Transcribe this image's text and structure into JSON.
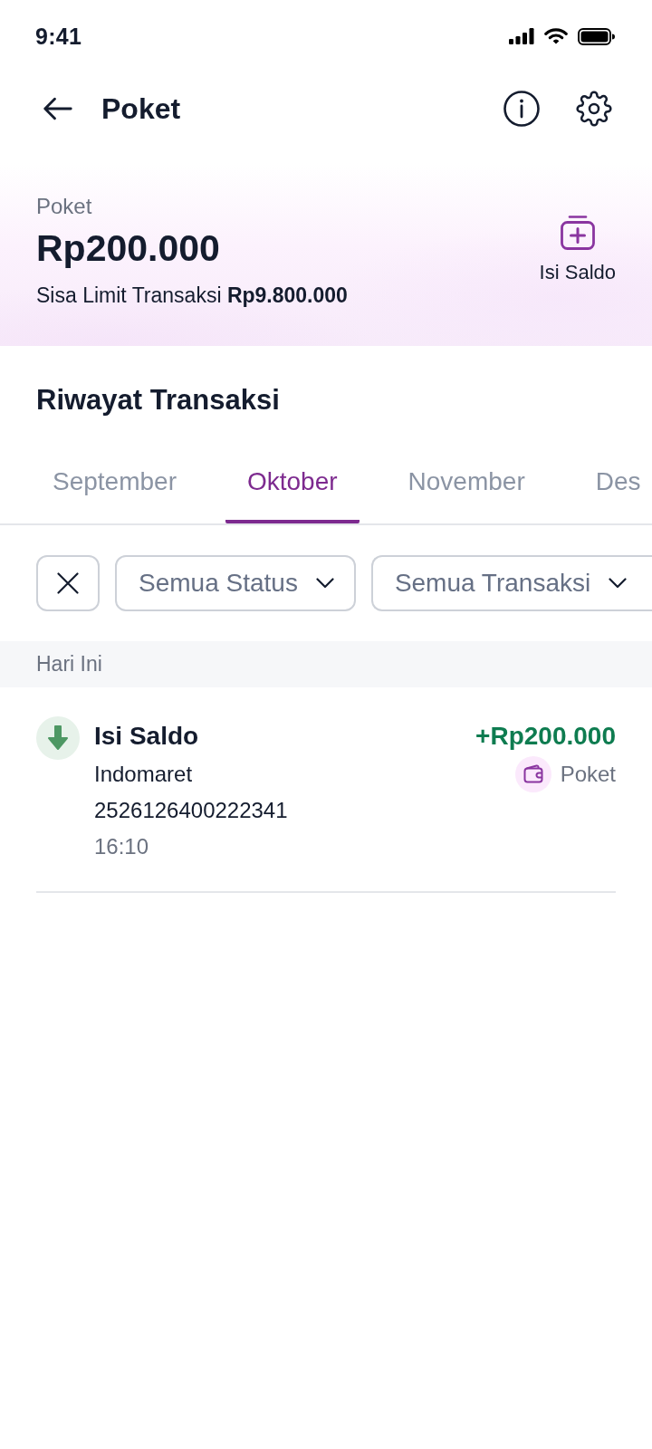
{
  "status_bar": {
    "time": "9:41"
  },
  "header": {
    "title": "Poket"
  },
  "balance_card": {
    "label": "Poket",
    "amount": "Rp200.000",
    "limit_text": "Sisa Limit Transaksi **Rp9.800.000**",
    "action": "Isi Saldo"
  },
  "history": {
    "title": "Riwayat Transaksi"
  },
  "tabs": [
    {
      "label": "September",
      "selected": false
    },
    {
      "label": "Oktober",
      "selected": true
    },
    {
      "label": "November",
      "selected": false
    },
    {
      "label": "Des",
      "selected": false
    }
  ],
  "filters": [
    {
      "label": "Semua Status"
    },
    {
      "label": "Semua Transaksi"
    }
  ],
  "groups": [
    {
      "title": "Hari Ini",
      "transactions": [
        {
          "kind": "incoming",
          "title": "Isi Saldo",
          "merchant": "Indomaret",
          "reference": "2526126400222341",
          "time": "16:10",
          "amount": "+Rp200.000",
          "source": "Poket"
        }
      ]
    }
  ]
}
